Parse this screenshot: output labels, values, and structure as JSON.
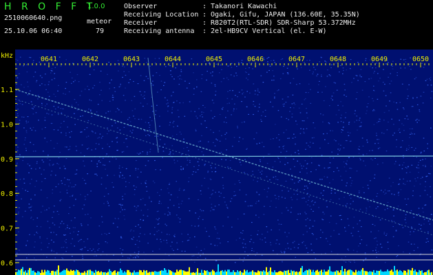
{
  "header": {
    "app_title": "H R O F F T",
    "app_version": "1.0.0",
    "file_name": "2510060640.png",
    "timestamp": "25.10.06 06:40",
    "detect_label": "meteor",
    "detect_count": "79",
    "info": [
      {
        "label": "Observer",
        "value": "Takanori Kawachi"
      },
      {
        "label": "Receiving Location",
        "value": "Ogaki, Gifu, JAPAN (136.60E, 35.35N)"
      },
      {
        "label": "Receiver",
        "value": "R820T2(RTL-SDR) SDR-Sharp 53.372MHz"
      },
      {
        "label": "Receiving antenna",
        "value": "2el-HB9CV Vertical (el. E-W)"
      }
    ],
    "separator": ":"
  },
  "spectrogram": {
    "freq_unit": "kHz",
    "freq_ticks": [
      "1.1",
      "1.0",
      "0.9",
      "0.8",
      "0.7",
      "0.6"
    ],
    "time_ticks": [
      "0641",
      "0642",
      "0643",
      "0644",
      "0645",
      "0646",
      "0647",
      "0648",
      "0649",
      "0650"
    ],
    "colors": {
      "background": "#001070",
      "noise": "#3a6cff",
      "signal": "#9ffcff",
      "ticks": "#f0f000",
      "reference_line": "#dddddd",
      "histogram_yellow": "#ffff00",
      "histogram_cyan": "#00d8ff"
    }
  }
}
